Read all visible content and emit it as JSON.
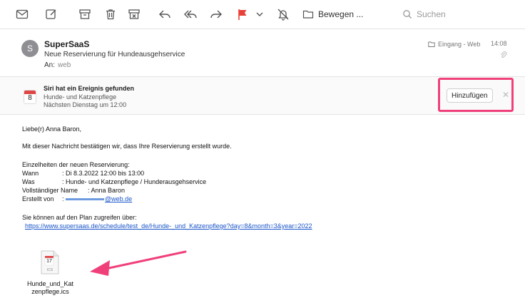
{
  "toolbar": {
    "icons": [
      "compose-mail-icon",
      "new-message-icon",
      "archive-icon",
      "trash-icon",
      "junk-icon",
      "reply-icon",
      "reply-all-icon",
      "forward-icon",
      "flag-icon",
      "flag-dropdown-icon",
      "mute-icon",
      "folder-icon"
    ],
    "move_label": "Bewegen ...",
    "search_placeholder": "Suchen",
    "flag_color": "#e8413a"
  },
  "message": {
    "avatar_initial": "S",
    "sender": "SuperSaaS",
    "subject": "Neue Reservierung für Hundeausgehservice",
    "to_label": "An:",
    "to_value": "web",
    "mailbox": "Eingang - Web",
    "time": "14:08"
  },
  "siri": {
    "cal_day": "8",
    "title": "Siri hat ein Ereignis gefunden",
    "line1": "Hunde- und Katzenpflege",
    "line2": "Nächsten Dienstag um 12:00",
    "add_label": "Hinzufügen",
    "highlight_color": "#f0407a"
  },
  "body": {
    "greeting": "Liebe(r) Anna Baron,",
    "intro": "Mit dieser Nachricht bestätigen wir, dass Ihre Reservierung erstellt wurde.",
    "details_heading": "Einzelheiten der neuen Reservierung:",
    "wann_label": "Wann",
    "wann_value": ": Di 8.3.2022 12:00 bis 13:00",
    "was_label": "Was",
    "was_value": ": Hunde- und Katzenpflege / Hunderausgehservice",
    "name_label": "Vollständiger Name",
    "name_value": ": Anna Baron",
    "created_label": "Erstellt von",
    "created_prefix": ":",
    "created_email_suffix": "@web.de",
    "plan_text": "Sie können auf den Plan zugreifen über:",
    "plan_url": "https://www.supersaas.de/schedule/test_de/Hunde-_und_Katzenpflege?day=8&month=3&year=2022"
  },
  "attachment": {
    "cal_day": "17",
    "ext": "ICS",
    "name_line1": "Hunde_und_Kat",
    "name_line2": "zenpflege.ics"
  },
  "annotation": {
    "arrow_color": "#f0407a"
  }
}
